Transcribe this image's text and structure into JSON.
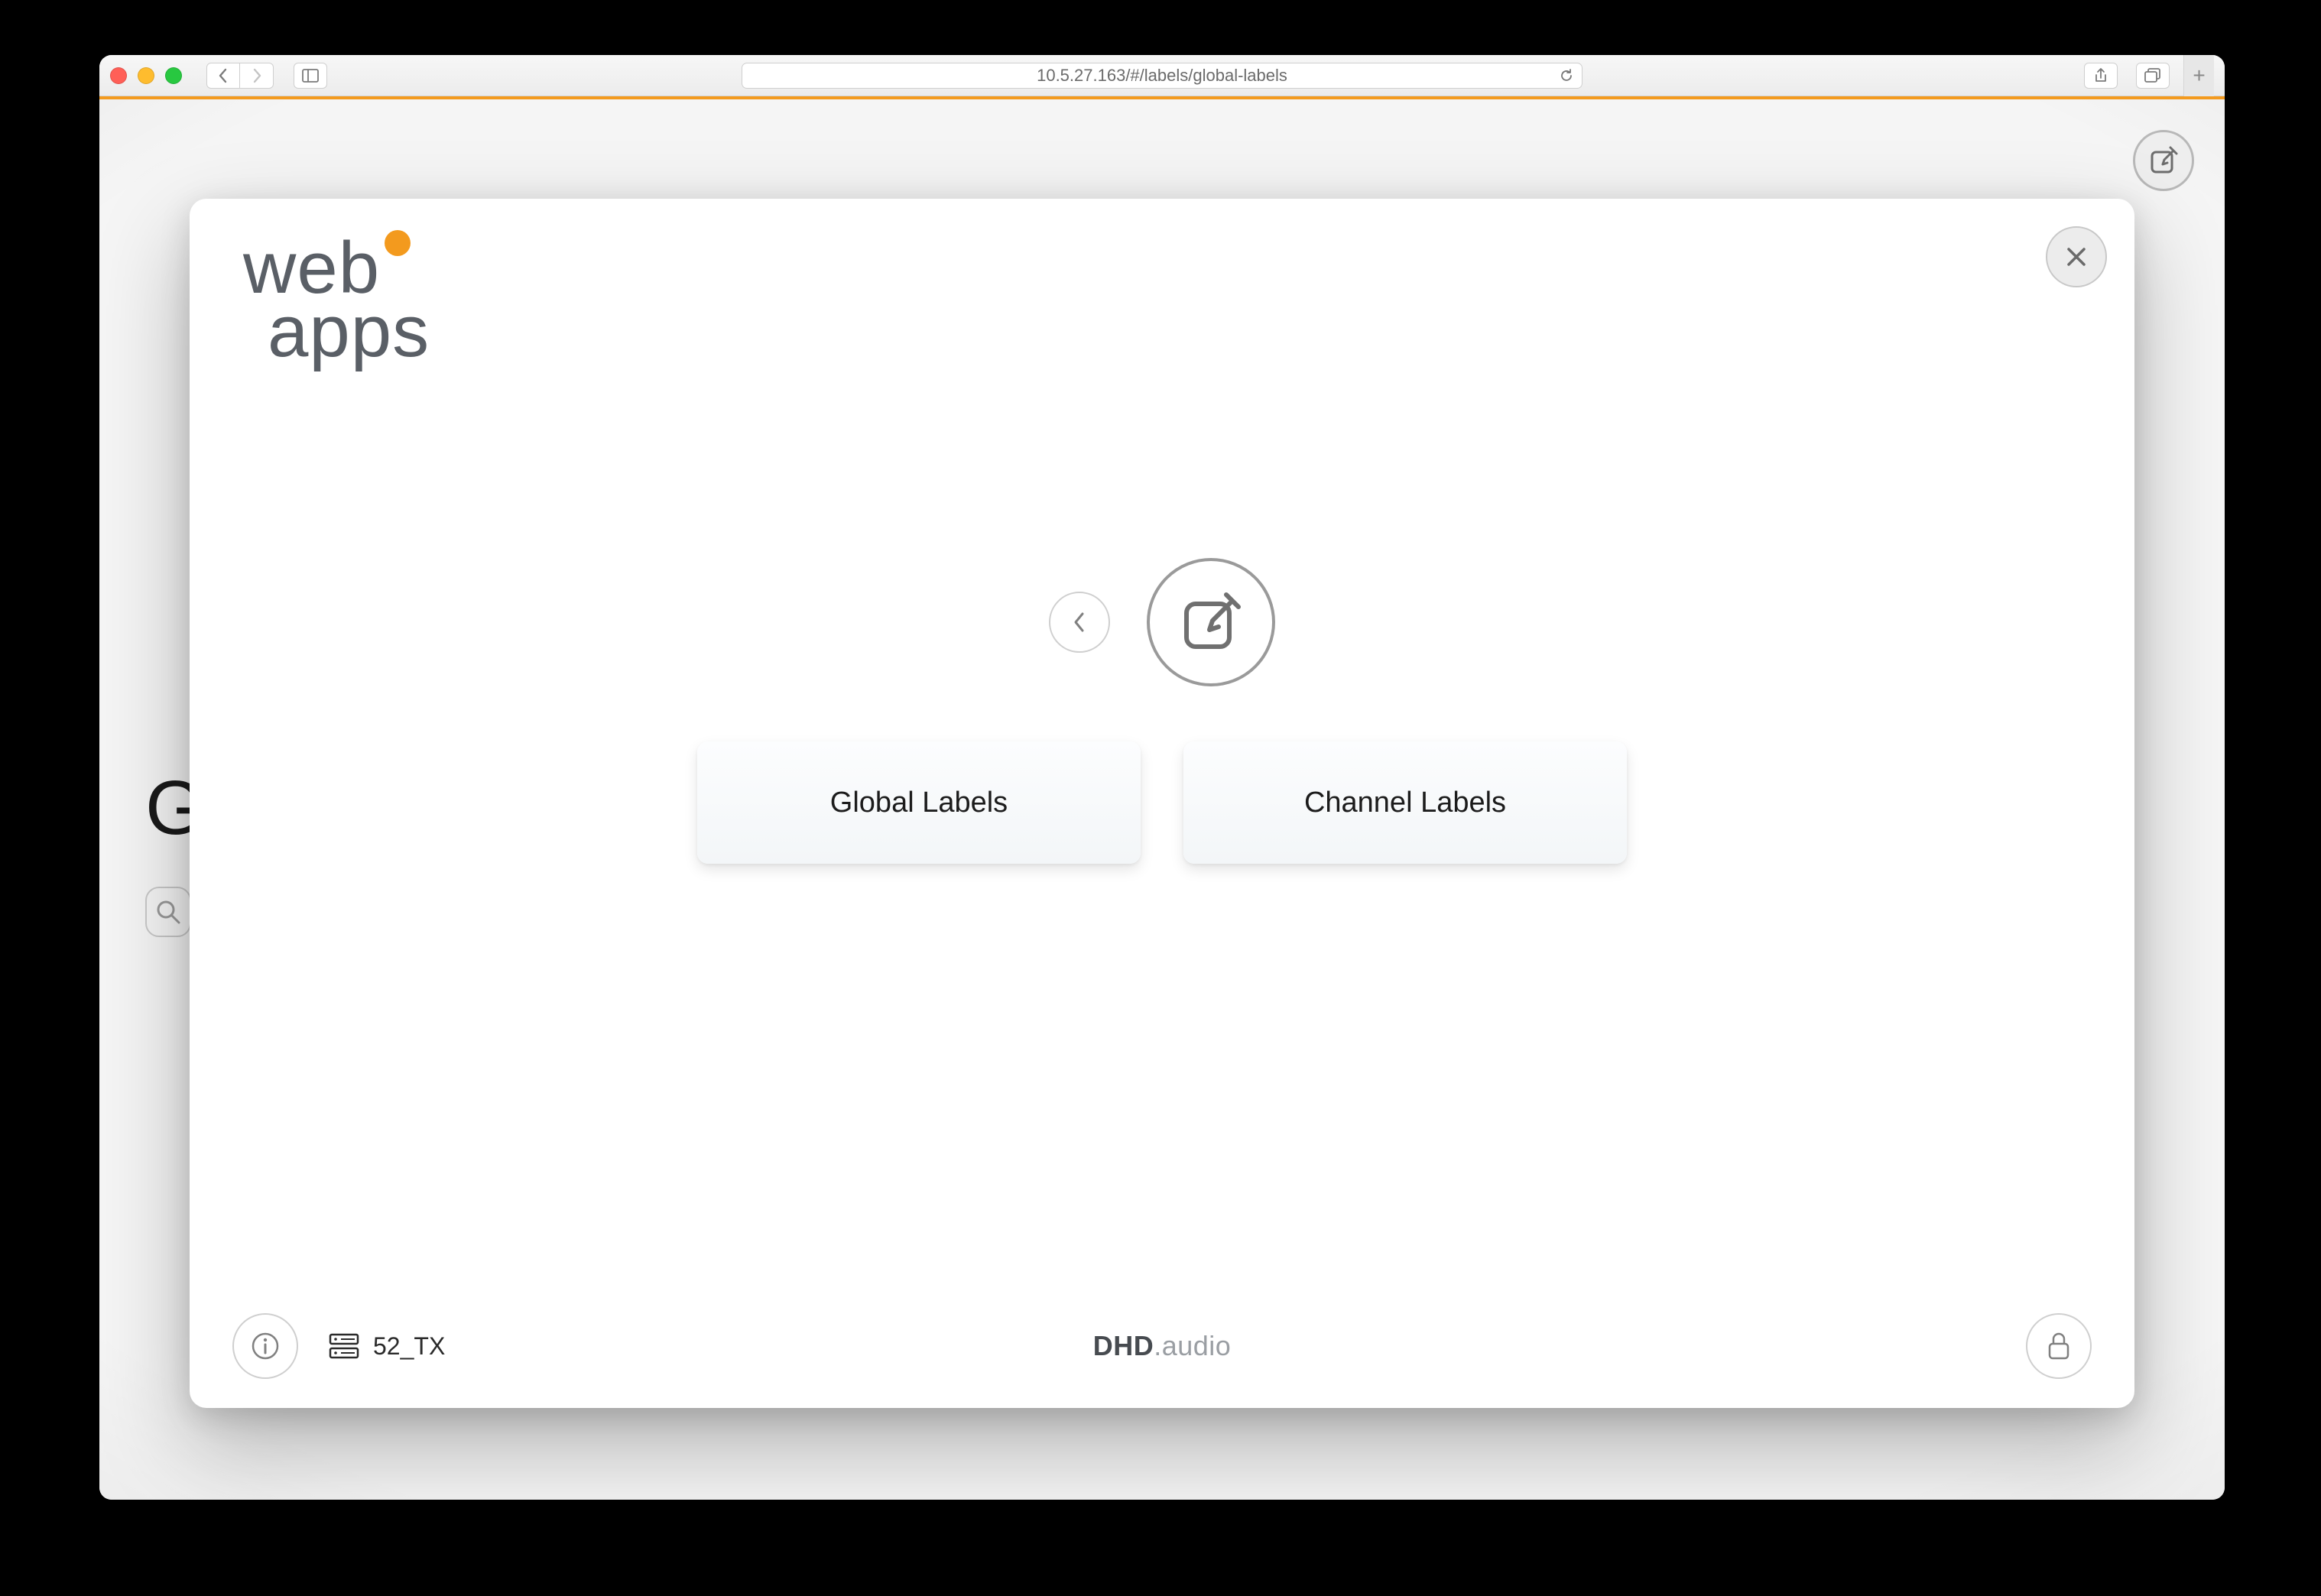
{
  "browser": {
    "url": "10.5.27.163/#/labels/global-labels"
  },
  "background": {
    "title_fragment": "G"
  },
  "modal": {
    "logo_line1": "web",
    "logo_line2": "apps",
    "cards": [
      {
        "label": "Global Labels"
      },
      {
        "label": "Channel Labels"
      }
    ],
    "footer": {
      "device_name": "52_TX",
      "brand_bold": "DHD",
      "brand_light": ".audio"
    }
  }
}
